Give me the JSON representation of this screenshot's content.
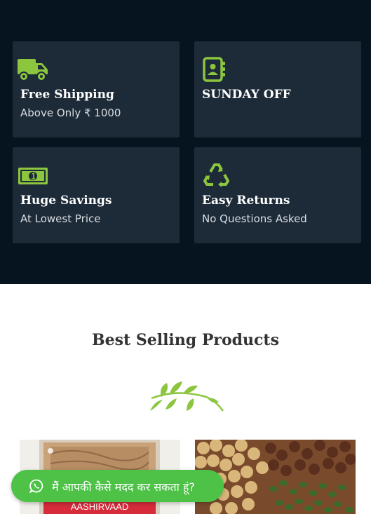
{
  "features": [
    {
      "title": "Free Shipping",
      "subtitle": "Above Only ₹ 1000",
      "icon": "truck-icon"
    },
    {
      "title": "SUNDAY OFF",
      "subtitle": "",
      "icon": "address-book-icon"
    },
    {
      "title": "Huge Savings",
      "subtitle": "At Lowest Price",
      "icon": "money-bill-icon"
    },
    {
      "title": "Easy Returns",
      "subtitle": "No Questions Asked",
      "icon": "recycle-icon"
    }
  ],
  "best_selling": {
    "title": "Best Selling Products",
    "products": [
      {
        "brand_label": "AASHIRVAAD"
      },
      {
        "brand_label": ""
      }
    ]
  },
  "whatsapp": {
    "text": "मैं आपकी कैसे मदद कर सकता हूं?"
  },
  "colors": {
    "dark_bg": "#06141f",
    "card_bg": "#1d2b38",
    "accent_green": "#8cc63f",
    "whatsapp_green": "#4dc247"
  }
}
